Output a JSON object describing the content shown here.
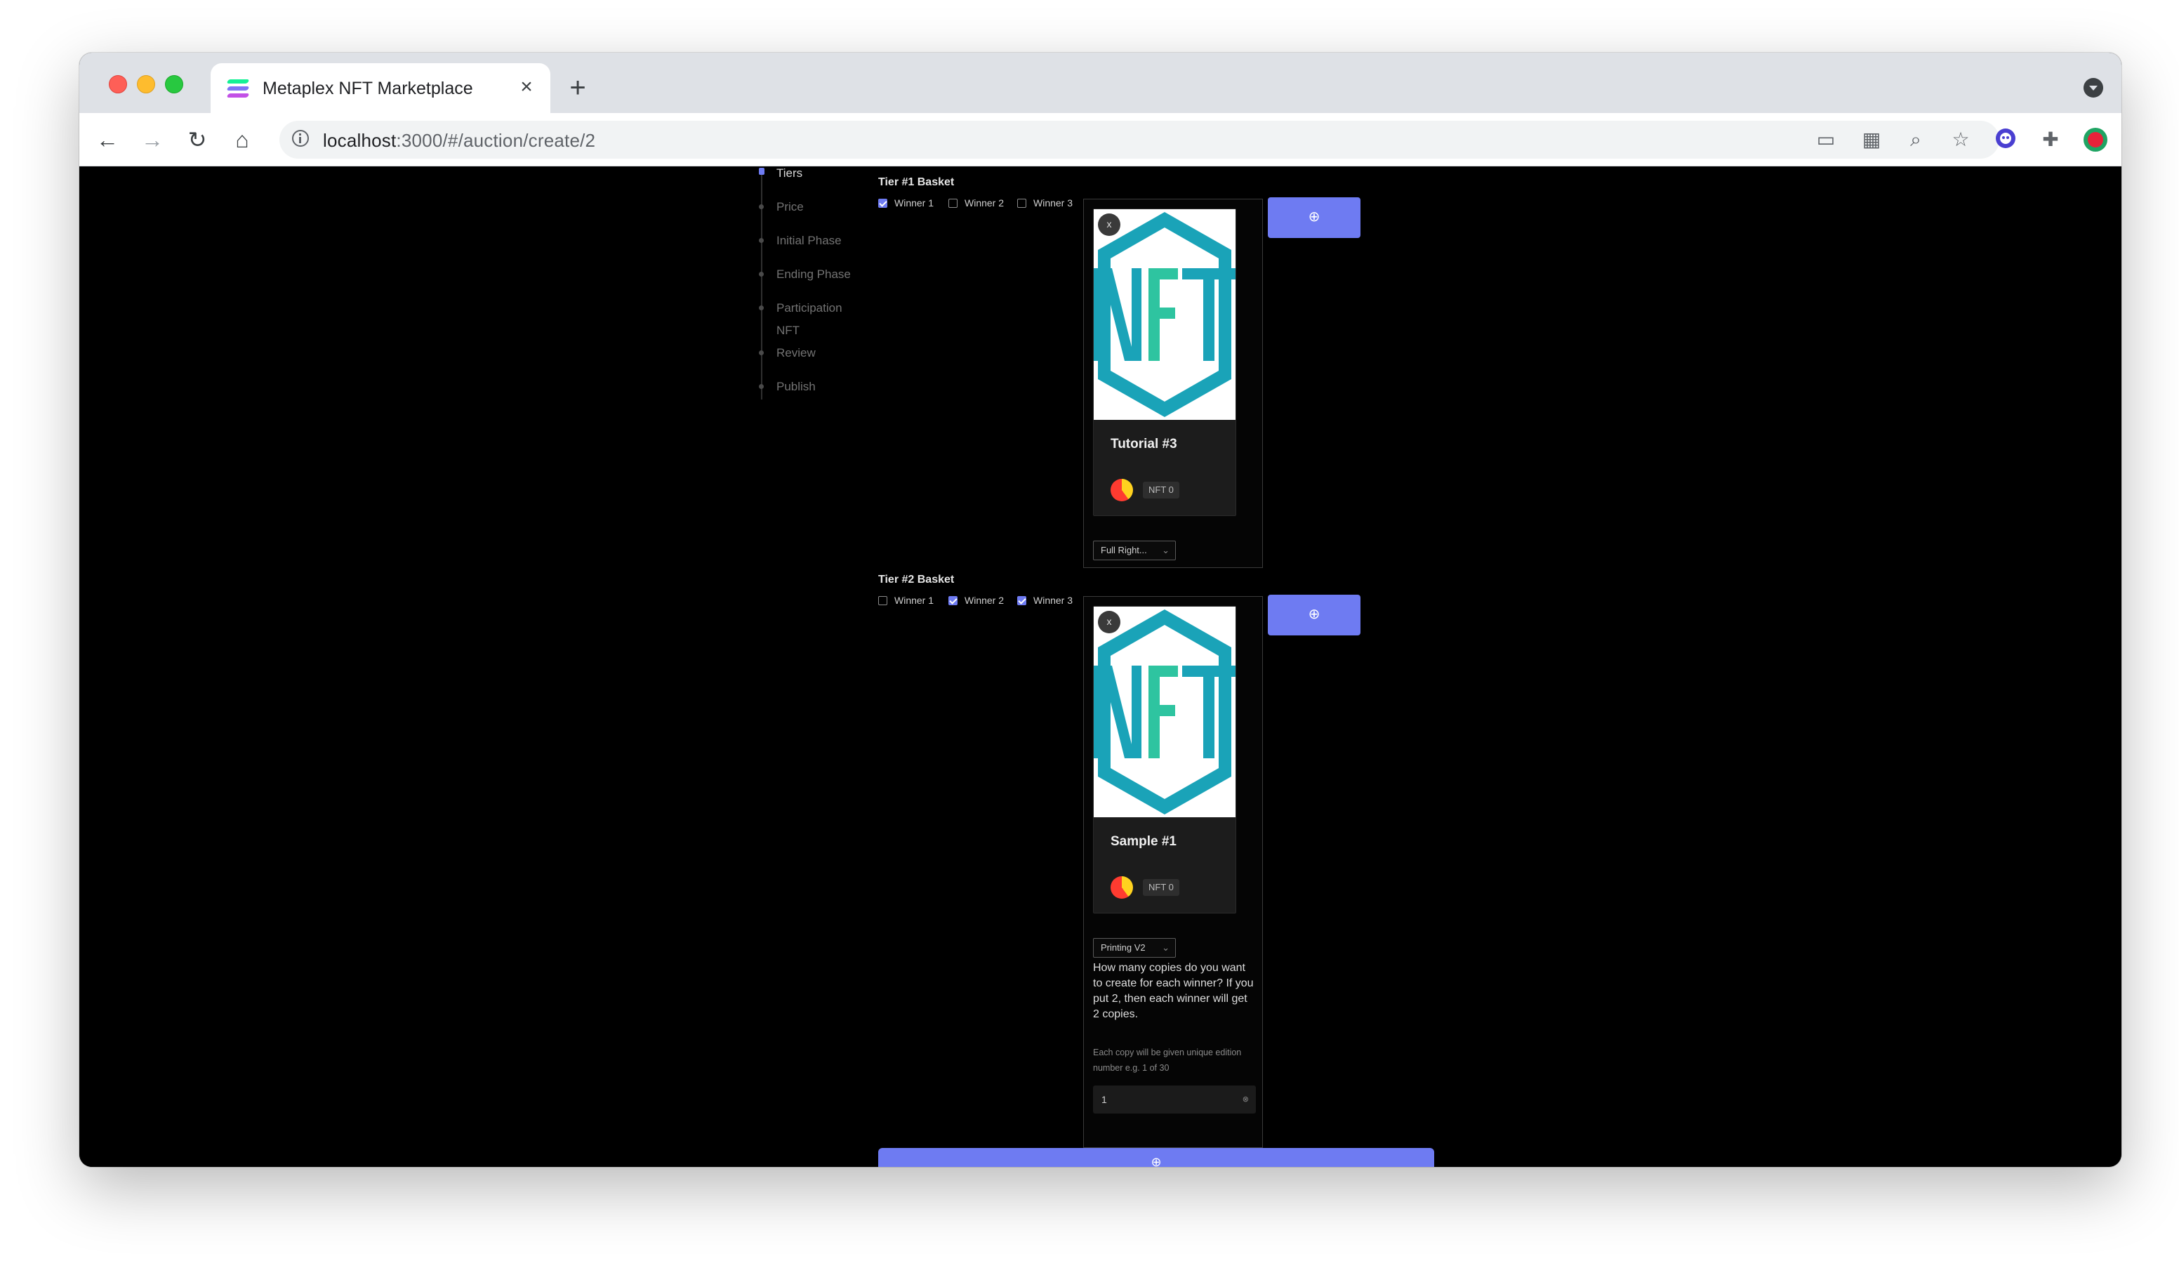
{
  "browser": {
    "tab_title": "Metaplex NFT Marketplace",
    "tab_close": "×",
    "new_tab": "+",
    "url_host": "localhost",
    "url_path": ":3000/#/auction/create/2"
  },
  "steps": [
    {
      "label": "Tiers",
      "active": true
    },
    {
      "label": "Price",
      "active": false
    },
    {
      "label": "Initial Phase",
      "active": false
    },
    {
      "label": "Ending Phase",
      "active": false
    },
    {
      "label": "Participation",
      "active": false
    },
    {
      "label": "NFT",
      "active": false
    },
    {
      "label": "Review",
      "active": false
    },
    {
      "label": "Publish",
      "active": false
    }
  ],
  "tiers": [
    {
      "title": "Tier #1 Basket",
      "winners": [
        {
          "label": "Winner 1",
          "checked": true
        },
        {
          "label": "Winner 2",
          "checked": false
        },
        {
          "label": "Winner 3",
          "checked": false
        }
      ],
      "card": {
        "close": "x",
        "name": "Tutorial #3",
        "tag": "NFT 0"
      },
      "select_value": "Full Right...",
      "add_icon": "⊕"
    },
    {
      "title": "Tier #2 Basket",
      "winners": [
        {
          "label": "Winner 1",
          "checked": false
        },
        {
          "label": "Winner 2",
          "checked": true
        },
        {
          "label": "Winner 3",
          "checked": true
        }
      ],
      "card": {
        "close": "x",
        "name": "Sample #1",
        "tag": "NFT 0"
      },
      "select_value": "Printing V2",
      "help_text": "How many copies do you want to create for each winner? If you put 2, then each winner will get 2 copies.",
      "help_small": "Each copy will be given unique edition number e.g. 1 of 30",
      "copies_value": "1",
      "add_icon": "⊕"
    }
  ],
  "continue_icon": "⊕",
  "colors": {
    "accent": "#6e7bf2",
    "teal": "#1aa3b8",
    "green": "#2ec4a0"
  }
}
